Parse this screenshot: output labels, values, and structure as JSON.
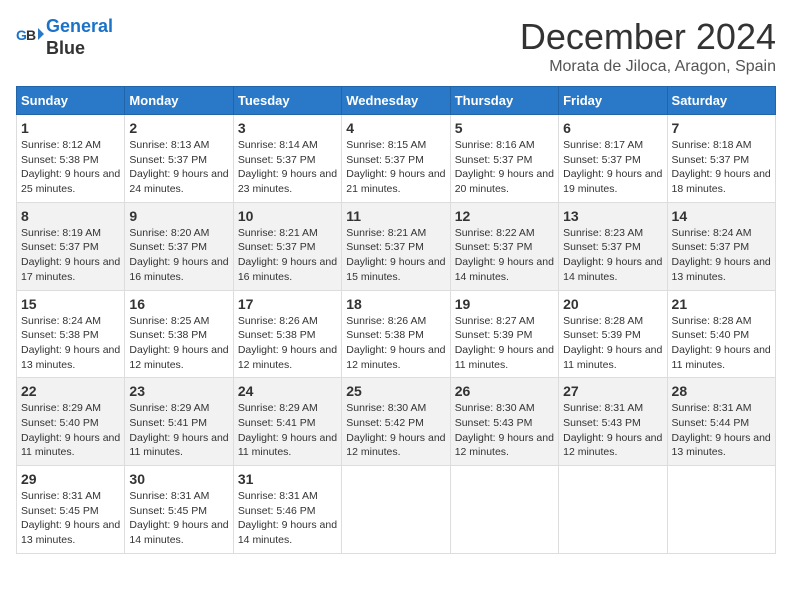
{
  "header": {
    "logo_line1": "General",
    "logo_line2": "Blue",
    "month": "December 2024",
    "location": "Morata de Jiloca, Aragon, Spain"
  },
  "weekdays": [
    "Sunday",
    "Monday",
    "Tuesday",
    "Wednesday",
    "Thursday",
    "Friday",
    "Saturday"
  ],
  "weeks": [
    [
      {
        "day": "1",
        "sunrise": "8:12 AM",
        "sunset": "5:38 PM",
        "daylight": "9 hours and 25 minutes."
      },
      {
        "day": "2",
        "sunrise": "8:13 AM",
        "sunset": "5:37 PM",
        "daylight": "9 hours and 24 minutes."
      },
      {
        "day": "3",
        "sunrise": "8:14 AM",
        "sunset": "5:37 PM",
        "daylight": "9 hours and 23 minutes."
      },
      {
        "day": "4",
        "sunrise": "8:15 AM",
        "sunset": "5:37 PM",
        "daylight": "9 hours and 21 minutes."
      },
      {
        "day": "5",
        "sunrise": "8:16 AM",
        "sunset": "5:37 PM",
        "daylight": "9 hours and 20 minutes."
      },
      {
        "day": "6",
        "sunrise": "8:17 AM",
        "sunset": "5:37 PM",
        "daylight": "9 hours and 19 minutes."
      },
      {
        "day": "7",
        "sunrise": "8:18 AM",
        "sunset": "5:37 PM",
        "daylight": "9 hours and 18 minutes."
      }
    ],
    [
      {
        "day": "8",
        "sunrise": "8:19 AM",
        "sunset": "5:37 PM",
        "daylight": "9 hours and 17 minutes."
      },
      {
        "day": "9",
        "sunrise": "8:20 AM",
        "sunset": "5:37 PM",
        "daylight": "9 hours and 16 minutes."
      },
      {
        "day": "10",
        "sunrise": "8:21 AM",
        "sunset": "5:37 PM",
        "daylight": "9 hours and 16 minutes."
      },
      {
        "day": "11",
        "sunrise": "8:21 AM",
        "sunset": "5:37 PM",
        "daylight": "9 hours and 15 minutes."
      },
      {
        "day": "12",
        "sunrise": "8:22 AM",
        "sunset": "5:37 PM",
        "daylight": "9 hours and 14 minutes."
      },
      {
        "day": "13",
        "sunrise": "8:23 AM",
        "sunset": "5:37 PM",
        "daylight": "9 hours and 14 minutes."
      },
      {
        "day": "14",
        "sunrise": "8:24 AM",
        "sunset": "5:37 PM",
        "daylight": "9 hours and 13 minutes."
      }
    ],
    [
      {
        "day": "15",
        "sunrise": "8:24 AM",
        "sunset": "5:38 PM",
        "daylight": "9 hours and 13 minutes."
      },
      {
        "day": "16",
        "sunrise": "8:25 AM",
        "sunset": "5:38 PM",
        "daylight": "9 hours and 12 minutes."
      },
      {
        "day": "17",
        "sunrise": "8:26 AM",
        "sunset": "5:38 PM",
        "daylight": "9 hours and 12 minutes."
      },
      {
        "day": "18",
        "sunrise": "8:26 AM",
        "sunset": "5:38 PM",
        "daylight": "9 hours and 12 minutes."
      },
      {
        "day": "19",
        "sunrise": "8:27 AM",
        "sunset": "5:39 PM",
        "daylight": "9 hours and 11 minutes."
      },
      {
        "day": "20",
        "sunrise": "8:28 AM",
        "sunset": "5:39 PM",
        "daylight": "9 hours and 11 minutes."
      },
      {
        "day": "21",
        "sunrise": "8:28 AM",
        "sunset": "5:40 PM",
        "daylight": "9 hours and 11 minutes."
      }
    ],
    [
      {
        "day": "22",
        "sunrise": "8:29 AM",
        "sunset": "5:40 PM",
        "daylight": "9 hours and 11 minutes."
      },
      {
        "day": "23",
        "sunrise": "8:29 AM",
        "sunset": "5:41 PM",
        "daylight": "9 hours and 11 minutes."
      },
      {
        "day": "24",
        "sunrise": "8:29 AM",
        "sunset": "5:41 PM",
        "daylight": "9 hours and 11 minutes."
      },
      {
        "day": "25",
        "sunrise": "8:30 AM",
        "sunset": "5:42 PM",
        "daylight": "9 hours and 12 minutes."
      },
      {
        "day": "26",
        "sunrise": "8:30 AM",
        "sunset": "5:43 PM",
        "daylight": "9 hours and 12 minutes."
      },
      {
        "day": "27",
        "sunrise": "8:31 AM",
        "sunset": "5:43 PM",
        "daylight": "9 hours and 12 minutes."
      },
      {
        "day": "28",
        "sunrise": "8:31 AM",
        "sunset": "5:44 PM",
        "daylight": "9 hours and 13 minutes."
      }
    ],
    [
      {
        "day": "29",
        "sunrise": "8:31 AM",
        "sunset": "5:45 PM",
        "daylight": "9 hours and 13 minutes."
      },
      {
        "day": "30",
        "sunrise": "8:31 AM",
        "sunset": "5:45 PM",
        "daylight": "9 hours and 14 minutes."
      },
      {
        "day": "31",
        "sunrise": "8:31 AM",
        "sunset": "5:46 PM",
        "daylight": "9 hours and 14 minutes."
      },
      {
        "day": "",
        "sunrise": "",
        "sunset": "",
        "daylight": ""
      },
      {
        "day": "",
        "sunrise": "",
        "sunset": "",
        "daylight": ""
      },
      {
        "day": "",
        "sunrise": "",
        "sunset": "",
        "daylight": ""
      },
      {
        "day": "",
        "sunrise": "",
        "sunset": "",
        "daylight": ""
      }
    ]
  ],
  "labels": {
    "sunrise_prefix": "Sunrise: ",
    "sunset_prefix": "Sunset: ",
    "daylight_prefix": "Daylight: "
  }
}
